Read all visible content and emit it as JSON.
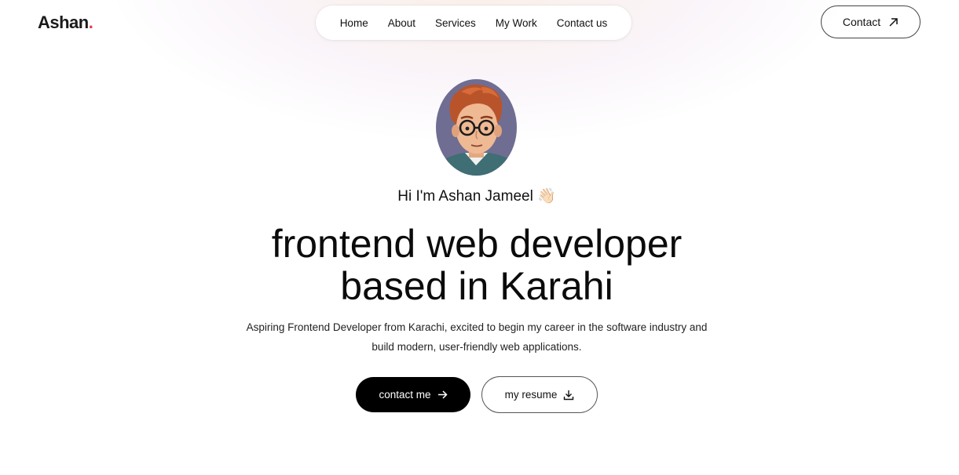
{
  "brand": {
    "name": "Ashan",
    "dot": ".",
    "accent_color": "#e63950"
  },
  "nav": {
    "items": [
      {
        "label": "Home"
      },
      {
        "label": "About"
      },
      {
        "label": "Services"
      },
      {
        "label": "My Work"
      },
      {
        "label": "Contact us"
      }
    ]
  },
  "header": {
    "contact_label": "Contact",
    "contact_icon": "arrow-up-right-icon"
  },
  "hero": {
    "greeting": "Hi I'm Ashan Jameel",
    "greeting_emoji": "👋🏻",
    "headline_line1": "frontend web developer",
    "headline_line2": "based in Karahi",
    "description": "Aspiring Frontend Developer from Karachi, excited to begin my career in the software industry and build modern, user-friendly web applications.",
    "primary_button": {
      "label": "contact me",
      "icon": "arrow-right-icon"
    },
    "secondary_button": {
      "label": "my resume",
      "icon": "download-icon"
    }
  }
}
